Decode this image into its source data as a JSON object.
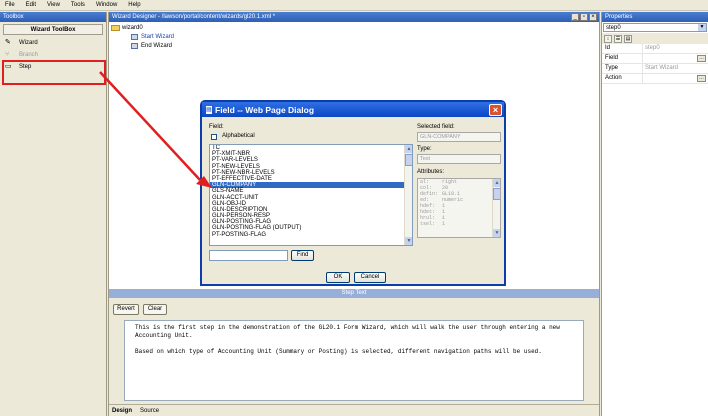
{
  "menu": [
    "File",
    "Edit",
    "View",
    "Tools",
    "Window",
    "Help"
  ],
  "toolbox": {
    "title": "Toolbox",
    "header": "Wizard ToolBox",
    "items": [
      {
        "label": "Wizard",
        "icon": "wrench-icon",
        "enabled": true
      },
      {
        "label": "Branch",
        "icon": "branch-icon",
        "enabled": false
      },
      {
        "label": "Step",
        "icon": "step-icon",
        "enabled": true
      }
    ]
  },
  "designer": {
    "title": "Wizard Designer - /lawson/portal/content/wizards/gl20.1.xml *",
    "tree": {
      "root": "wizard0",
      "children": [
        "Start Wizard",
        "End Wizard"
      ]
    },
    "step_text": {
      "header": "Step Text",
      "revert_label": "Revert",
      "clear_label": "Clear",
      "paragraphs": [
        "This is the first step in the demonstration of the GL20.1 Form Wizard, which will walk the user through entering a new Accounting Unit.",
        "Based on which type of Accounting Unit (Summary or Posting) is selected, different navigation paths will be used."
      ]
    },
    "tabs": [
      "Design",
      "Source"
    ]
  },
  "properties": {
    "title": "Properties",
    "selected": "step0",
    "rows": [
      {
        "key": "Id",
        "value": "step0",
        "has_button": false
      },
      {
        "key": "Field",
        "value": "",
        "has_button": true
      },
      {
        "key": "Type",
        "value": "Start Wizard",
        "has_button": false
      },
      {
        "key": "Action",
        "value": "",
        "has_button": true
      }
    ]
  },
  "dialog": {
    "title": "Field -- Web Page Dialog",
    "field_label": "Field:",
    "alphabetical_label": "Alphabetical",
    "fields": [
      "TC",
      "PT-XMIT-NBR",
      "PT-VAR-LEVELS",
      "PT-NEW-LEVELS",
      "PT-NEW-NBR-LEVELS",
      "PT-EFFECTIVE-DATE",
      "GLN-COMPANY",
      "GLS-NAME",
      "GLN-ACCT-UNIT",
      "GLN-OBJ-ID",
      "GLN-DESCRIPTION",
      "GLN-PERSON-RESP",
      "GLN-POSTING-FLAG",
      "GLN-POSTING-FLAG (OUTPUT)",
      "PT-POSTING-FLAG"
    ],
    "selected_field_index": 6,
    "find_label": "Find",
    "find_value": "",
    "selected_field_label": "Selected field:",
    "selected_field_value": "GLN-COMPANY",
    "type_label": "Type:",
    "type_value": "Text",
    "attributes_label": "Attributes:",
    "attributes": [
      {
        "k": "al:",
        "v": "right"
      },
      {
        "k": "col:",
        "v": "20"
      },
      {
        "k": "defin:",
        "v": "GL10.1"
      },
      {
        "k": "ed:",
        "v": "numeric"
      },
      {
        "k": "hdef:",
        "v": "1"
      },
      {
        "k": "hdet:",
        "v": "1"
      },
      {
        "k": "hrul:",
        "v": "1"
      },
      {
        "k": "tsel:",
        "v": "1"
      }
    ],
    "ok_label": "OK",
    "cancel_label": "Cancel"
  },
  "colors": {
    "title_bar": "#2d5fb5",
    "dialog_title": "#0a47c4",
    "highlight": "#e02020",
    "selection": "#316ac5"
  }
}
